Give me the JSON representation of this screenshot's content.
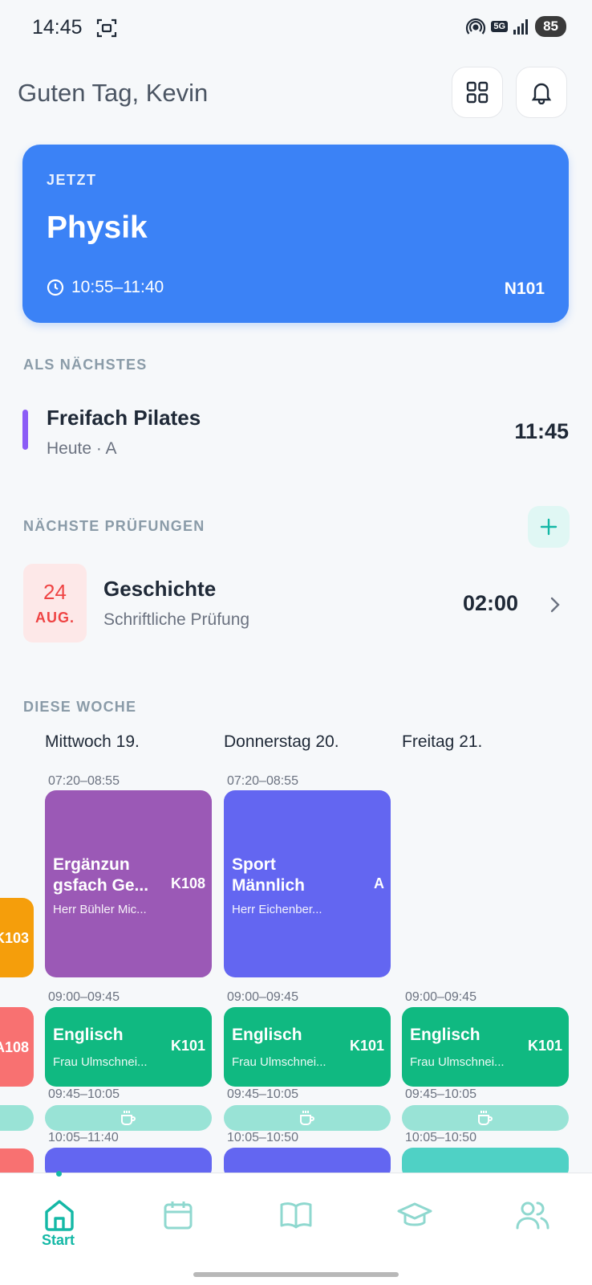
{
  "status": {
    "time": "14:45",
    "network": "5G",
    "battery": "85"
  },
  "header": {
    "greeting": "Guten Tag, Kevin"
  },
  "now": {
    "label": "JETZT",
    "subject": "Physik",
    "time": "10:55–11:40",
    "room": "N101"
  },
  "next": {
    "section_label": "ALS NÄCHSTES",
    "subject": "Freifach Pilates",
    "meta": "Heute · A",
    "time": "11:45",
    "accent": "#8B5CF6"
  },
  "exams": {
    "section_label": "NÄCHSTE PRÜFUNGEN",
    "day": "24",
    "month": "AUG.",
    "subject": "Geschichte",
    "type": "Schriftliche Prüfung",
    "time": "02:00"
  },
  "week": {
    "section_label": "DIESE WOCHE",
    "days": [
      "Mittwoch 19.",
      "Donnerstag 20.",
      "Freitag 21."
    ],
    "wed": {
      "slot1_time": "07:20–08:55",
      "lesson1": {
        "title": "Ergänzun gsfach Ge...",
        "teacher": "Herr Bühler Mic...",
        "room": "K108",
        "color": "#9B59B6"
      },
      "slot2_time": "09:00–09:45",
      "lesson2": {
        "title": "Englisch",
        "teacher": "Frau Ulmschnei...",
        "room": "K101",
        "color": "#10B981"
      },
      "break_time": "09:45–10:05",
      "slot3_time": "10:05–11:40"
    },
    "thu": {
      "slot1_time": "07:20–08:55",
      "lesson1": {
        "title": "Sport Männlich",
        "teacher": "Herr Eichenber...",
        "room": "A",
        "color": "#6366F1"
      },
      "slot2_time": "09:00–09:45",
      "lesson2": {
        "title": "Englisch",
        "teacher": "Frau Ulmschnei...",
        "room": "K101",
        "color": "#10B981"
      },
      "break_time": "09:45–10:05",
      "slot3_time": "10:05–10:50"
    },
    "fri": {
      "slot2_time": "09:00–09:45",
      "lesson2": {
        "title": "Englisch",
        "teacher": "Frau Ulmschnei...",
        "room": "K101",
        "color": "#10B981"
      },
      "break_time": "09:45–10:05",
      "slot3_time": "10:05–10:50"
    },
    "edge": {
      "room1": "K103",
      "room2": "A108"
    }
  },
  "nav": {
    "active_label": "Start",
    "items": [
      "home-icon",
      "calendar-icon",
      "book-icon",
      "graduation-cap-icon",
      "users-icon"
    ]
  },
  "colors": {
    "accent": "#14B8A6",
    "now_card": "#3B82F6"
  }
}
